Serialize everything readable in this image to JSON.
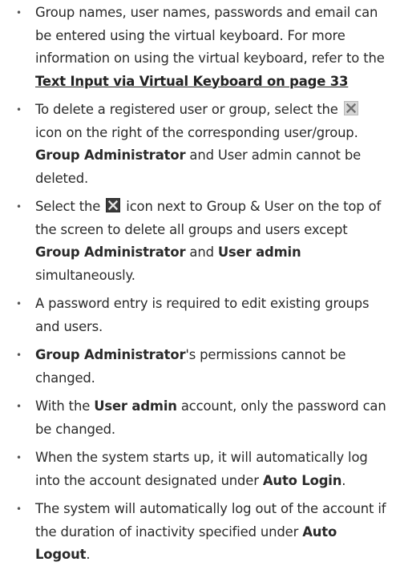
{
  "colors": {
    "text": "#2a2a2a",
    "icon_light_bg": "#d6d6d6",
    "icon_light_x": "#707070",
    "icon_dark_bg": "#3b3b3b",
    "icon_dark_x": "#e8e8e8"
  },
  "icons": {
    "delete_single": "close-icon",
    "delete_all": "close-icon"
  },
  "bullets": [
    {
      "t1": "Group names, user names, passwords and email can be entered using the virtual keyboard. For more information on using the virtual keyboard, refer to the ",
      "link": "Text Input via Virtual Keyboard on page 33"
    },
    {
      "t1": "To delete a registered user or group, select the ",
      "t2": " icon on the right of the corresponding user/group. ",
      "b1": "Group Administrator",
      "t3": " and User admin cannot be deleted."
    },
    {
      "t1": "Select the ",
      "t2": " icon next to Group & User on the top of the screen to delete all groups and users except ",
      "b1": "Group Administrator",
      "t3": " and ",
      "b2": "User admin",
      "t4": " simultaneously."
    },
    {
      "t1": "A password entry is required to edit existing groups and users."
    },
    {
      "b1": "Group Administrator",
      "t1": "'s permissions cannot be changed."
    },
    {
      "t1": "With the ",
      "b1": "User admin",
      "t2": " account, only the password can be changed."
    },
    {
      "t1": "When the system starts up, it will automatically log into the account designated under ",
      "b1": "Auto Login",
      "t2": "."
    },
    {
      "t1": "The system will automatically log out of the account if the duration of inactivity specified under ",
      "b1": "Auto Logout",
      "t2": "."
    }
  ]
}
